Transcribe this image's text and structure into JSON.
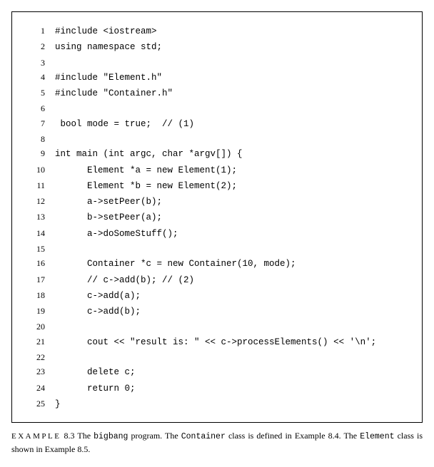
{
  "code": {
    "lines": [
      {
        "n": "1",
        "text": "#include <iostream>"
      },
      {
        "n": "2",
        "text": "using namespace std;"
      },
      {
        "n": "3",
        "text": ""
      },
      {
        "n": "4",
        "text": "#include \"Element.h\""
      },
      {
        "n": "5",
        "text": "#include \"Container.h\""
      },
      {
        "n": "6",
        "text": ""
      },
      {
        "n": "7",
        "text": " bool mode = true;  // (1)"
      },
      {
        "n": "8",
        "text": ""
      },
      {
        "n": "9",
        "text": "int main (int argc, char *argv[]) {"
      },
      {
        "n": "10",
        "text": "      Element *a = new Element(1);"
      },
      {
        "n": "11",
        "text": "      Element *b = new Element(2);"
      },
      {
        "n": "12",
        "text": "      a->setPeer(b);"
      },
      {
        "n": "13",
        "text": "      b->setPeer(a);"
      },
      {
        "n": "14",
        "text": "      a->doSomeStuff();"
      },
      {
        "n": "15",
        "text": ""
      },
      {
        "n": "16",
        "text": "      Container *c = new Container(10, mode);"
      },
      {
        "n": "17",
        "text": "      // c->add(b); // (2)"
      },
      {
        "n": "18",
        "text": "      c->add(a);"
      },
      {
        "n": "19",
        "text": "      c->add(b);"
      },
      {
        "n": "20",
        "text": ""
      },
      {
        "n": "21",
        "text": "      cout << \"result is: \" << c->processElements() << '\\n';"
      },
      {
        "n": "22",
        "text": ""
      },
      {
        "n": "23",
        "text": "      delete c;"
      },
      {
        "n": "24",
        "text": "      return 0;"
      },
      {
        "n": "25",
        "text": "}"
      }
    ]
  },
  "caption": {
    "lead": "EXAMPLE",
    "number": "8.3",
    "t1": "The ",
    "prog": "bigbang",
    "t2": " program. The ",
    "class1": "Container",
    "t3": " class is defined in Example 8.4. The ",
    "class2": "Element",
    "t4": " class is shown in Example 8.5."
  }
}
